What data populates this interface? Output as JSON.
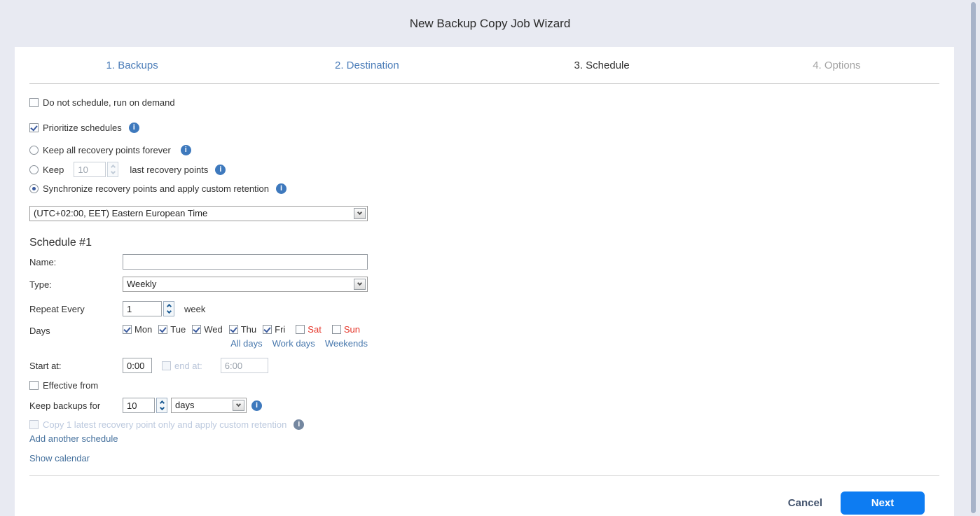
{
  "page": {
    "title": "New Backup Copy Job Wizard"
  },
  "tabs": {
    "backups": "1. Backups",
    "destination": "2. Destination",
    "schedule": "3. Schedule",
    "options": "4. Options"
  },
  "retention": {
    "run_on_demand_label": "Do not schedule, run on demand",
    "prioritize_label": "Prioritize schedules",
    "keep_all_label": "Keep all recovery points forever",
    "keep_prefix": "Keep",
    "keep_count": "10",
    "keep_suffix": "last recovery points",
    "synchronize_label": "Synchronize recovery points and apply custom retention",
    "timezone_value": "(UTC+02:00, EET) Eastern European Time"
  },
  "schedule": {
    "heading": "Schedule #1",
    "name_label": "Name:",
    "name_value": "",
    "type_label": "Type:",
    "type_value": "Weekly",
    "repeat_label": "Repeat Every",
    "repeat_value": "1",
    "repeat_unit": "week",
    "days_label": "Days",
    "days": [
      {
        "label": "Mon",
        "checked": true,
        "weekend": false
      },
      {
        "label": "Tue",
        "checked": true,
        "weekend": false
      },
      {
        "label": "Wed",
        "checked": true,
        "weekend": false
      },
      {
        "label": "Thu",
        "checked": true,
        "weekend": false
      },
      {
        "label": "Fri",
        "checked": true,
        "weekend": false
      },
      {
        "label": "Sat",
        "checked": false,
        "weekend": true
      },
      {
        "label": "Sun",
        "checked": false,
        "weekend": true
      }
    ],
    "day_links": [
      "All days",
      "Work days",
      "Weekends"
    ],
    "start_label": "Start at:",
    "start_value": "0:00",
    "end_label": "end at:",
    "end_value": "6:00",
    "effective_label": "Effective from",
    "keep_backups_label": "Keep backups for",
    "keep_backups_value": "10",
    "keep_backups_unit": "days",
    "copy_latest_label": "Copy 1 latest recovery point only and apply custom retention",
    "add_schedule_link": "Add another schedule",
    "show_calendar_link": "Show calendar"
  },
  "footer": {
    "cancel": "Cancel",
    "next": "Next"
  },
  "colors": {
    "accent_blue": "#0d7cf2",
    "link_blue": "#4878ad",
    "weekend_red": "#e53529",
    "check_blue": "#3a5a9e",
    "info_blue": "#3e79bd"
  }
}
